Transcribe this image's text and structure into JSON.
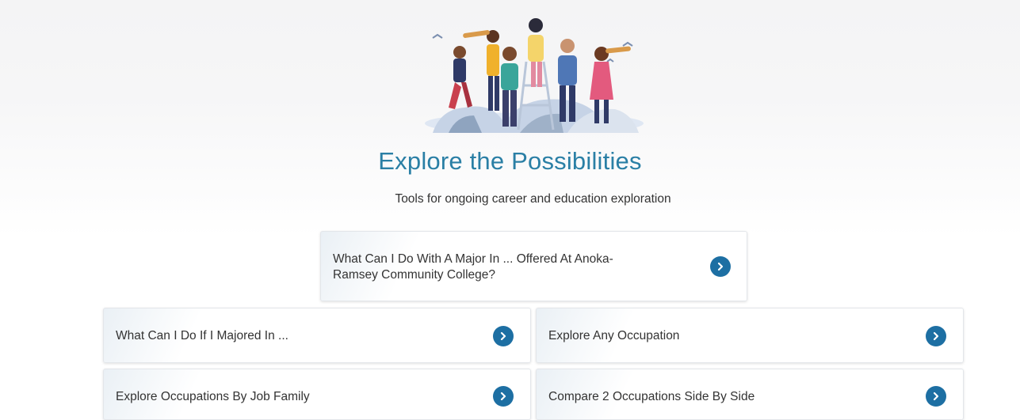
{
  "hero": {
    "icon": "explorers-with-telescopes-illustration"
  },
  "title": "Explore the Possibilities",
  "subtitle": "Tools for ongoing career and education exploration",
  "cards": [
    {
      "label": "What Can I Do With A Major In ... Offered At Anoka-Ramsey Community College?",
      "line1": "What Can I Do With A Major In ... Offered At Anoka-",
      "line2": "Ramsey Community College?",
      "icon": "chevron-right-icon"
    },
    {
      "label": "What Can I Do If I Majored In ...",
      "icon": "chevron-right-icon"
    },
    {
      "label": "Explore Any Occupation",
      "icon": "chevron-right-icon"
    },
    {
      "label": "Explore Occupations By Job Family",
      "icon": "chevron-right-icon"
    },
    {
      "label": "Compare 2 Occupations Side By Side",
      "icon": "chevron-right-icon"
    }
  ],
  "colors": {
    "title": "#2a7fa5",
    "button": "#1d6fa3"
  }
}
